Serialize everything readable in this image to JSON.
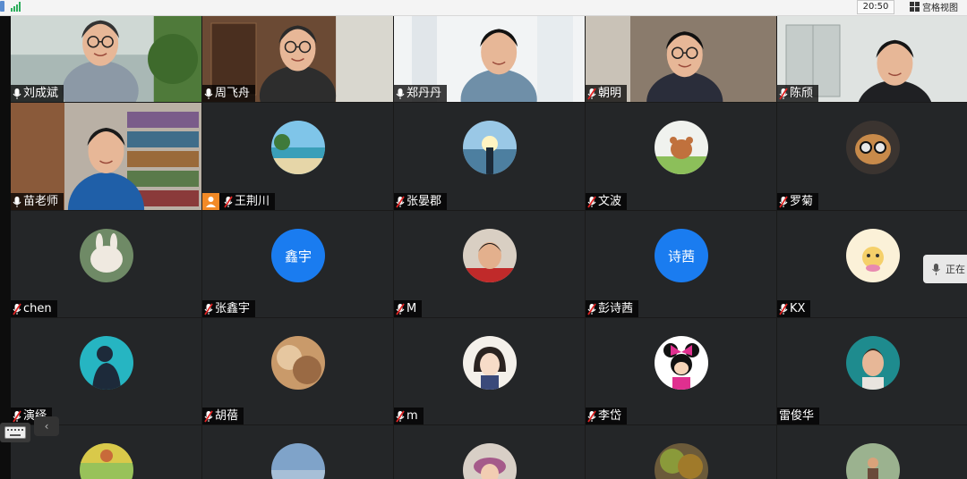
{
  "top_bar": {
    "clock": "20:50",
    "grid_view_label": "宫格视图"
  },
  "speaking_tip": {
    "text": "正在"
  },
  "tiles": [
    {
      "name": "刘成斌",
      "kind": "video",
      "mic": "on",
      "scene": "lake"
    },
    {
      "name": "周飞舟",
      "kind": "video",
      "mic": "on",
      "scene": "office-wood"
    },
    {
      "name": "郑丹丹",
      "kind": "video",
      "mic": "on",
      "scene": "white-room",
      "active": true
    },
    {
      "name": "朝明",
      "kind": "video",
      "mic": "muted",
      "scene": "dark-room"
    },
    {
      "name": "陈颀",
      "kind": "video",
      "mic": "muted",
      "scene": "cabinet"
    },
    {
      "name": "苗老师",
      "kind": "video",
      "mic": "on",
      "scene": "bookshelf"
    },
    {
      "name": "王荆川",
      "kind": "photo",
      "mic": "muted",
      "host_badge": true,
      "avatar_scene": "beach"
    },
    {
      "name": "张晏郡",
      "kind": "photo",
      "mic": "muted",
      "avatar_scene": "sunset"
    },
    {
      "name": "文波",
      "kind": "photo",
      "mic": "muted",
      "avatar_scene": "cartoon-bear"
    },
    {
      "name": "罗菊",
      "kind": "photo",
      "mic": "muted",
      "avatar_scene": "cat-glasses"
    },
    {
      "name": "chen",
      "kind": "photo",
      "mic": "muted",
      "avatar_scene": "rabbit"
    },
    {
      "name": "张鑫宇",
      "kind": "text",
      "mic": "muted",
      "avatar_text": "鑫宇"
    },
    {
      "name": "M",
      "kind": "photo",
      "mic": "muted",
      "avatar_scene": "boy"
    },
    {
      "name": "彭诗茜",
      "kind": "text",
      "mic": "muted",
      "avatar_text": "诗茜"
    },
    {
      "name": "KX",
      "kind": "photo",
      "mic": "muted",
      "avatar_scene": "cartoon-cream"
    },
    {
      "name": "演绎",
      "kind": "photo",
      "mic": "muted",
      "avatar_scene": "silhouette-teal"
    },
    {
      "name": "胡蓓",
      "kind": "photo",
      "mic": "muted",
      "avatar_scene": "blurry-warm"
    },
    {
      "name": "m",
      "kind": "photo",
      "mic": "muted",
      "avatar_scene": "anime-girl"
    },
    {
      "name": "李岱",
      "kind": "photo",
      "mic": "muted",
      "avatar_scene": "minnie"
    },
    {
      "name": "雷俊华",
      "kind": "photo",
      "mic": "none",
      "avatar_scene": "man-teal"
    },
    {
      "name": "",
      "kind": "photo",
      "mic": "none",
      "avatar_scene": "green-field"
    },
    {
      "name": "",
      "kind": "photo",
      "mic": "none",
      "avatar_scene": "sky-blue"
    },
    {
      "name": "",
      "kind": "photo",
      "mic": "none",
      "avatar_scene": "girl-hat"
    },
    {
      "name": "",
      "kind": "photo",
      "mic": "none",
      "avatar_scene": "forest"
    },
    {
      "name": "",
      "kind": "photo",
      "mic": "none",
      "avatar_scene": "person-outdoor"
    }
  ],
  "colors": {
    "tile_bg": "#242628",
    "text_avatar_bg": "#1a7cf0",
    "host_badge": "#f28a26",
    "active_border": "#16a34a",
    "muted_slash": "#e02424"
  }
}
